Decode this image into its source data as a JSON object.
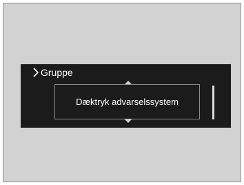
{
  "screen": {
    "header": {
      "icon": "chevron-right-icon",
      "title": "Gruppe"
    },
    "menu": {
      "up_icon": "chevron-up-icon",
      "down_icon": "chevron-down-icon",
      "selected_item": "Dæktryk advarselssystem"
    },
    "colors": {
      "background": "#d2d2d2",
      "display": "#1b1b1b",
      "text": "#ffffff"
    }
  }
}
